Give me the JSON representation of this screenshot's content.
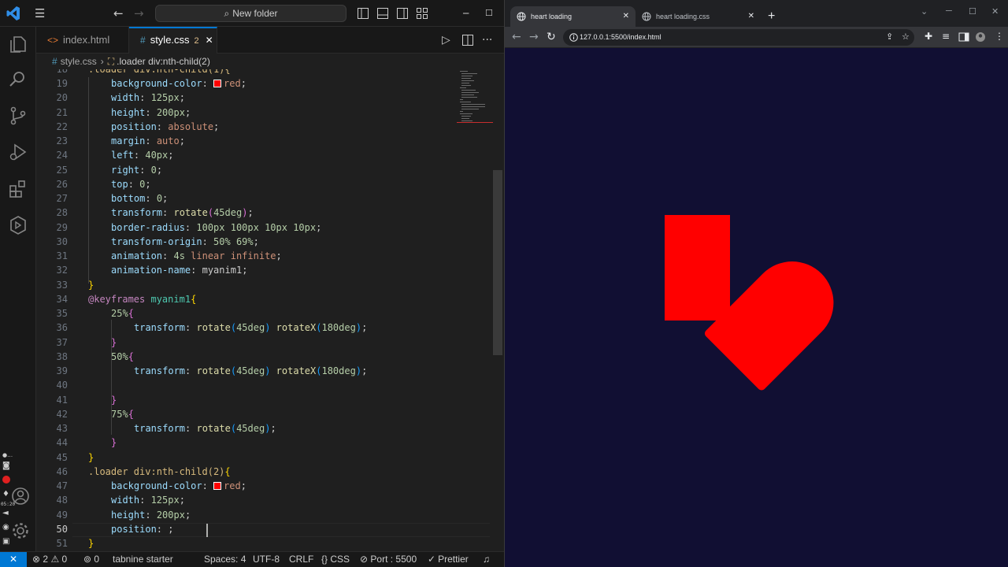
{
  "vscode": {
    "search_label": "New folder",
    "tabs": [
      {
        "label": "index.html",
        "icon": "html-file-icon"
      },
      {
        "label": "style.css",
        "icon": "css-file-icon",
        "badge": "2"
      }
    ],
    "breadcrumb": [
      "style.css",
      ".loader div:nth-child(2)"
    ],
    "partial_top_line": ".loader div:nth-child(1){",
    "lines": [
      {
        "n": "19",
        "indent": 4,
        "tokens": [
          [
            "k-prop",
            "background-color"
          ],
          [
            "",
            "",
            ""
          ],
          [
            "",
            ": "
          ],
          [
            "swatch",
            ""
          ],
          [
            "k-val",
            "red"
          ],
          [
            "",
            ";"
          ]
        ]
      },
      {
        "n": "20",
        "indent": 4,
        "tokens": [
          [
            "k-prop",
            "width"
          ],
          [
            "",
            ": "
          ],
          [
            "k-num",
            "125px"
          ],
          [
            "",
            ";"
          ]
        ]
      },
      {
        "n": "21",
        "indent": 4,
        "tokens": [
          [
            "k-prop",
            "height"
          ],
          [
            "",
            ": "
          ],
          [
            "k-num",
            "200px"
          ],
          [
            "",
            ";"
          ]
        ]
      },
      {
        "n": "22",
        "indent": 4,
        "tokens": [
          [
            "k-prop",
            "position"
          ],
          [
            "",
            ": "
          ],
          [
            "k-val",
            "absolute"
          ],
          [
            "",
            ";"
          ]
        ]
      },
      {
        "n": "23",
        "indent": 4,
        "tokens": [
          [
            "k-prop",
            "margin"
          ],
          [
            "",
            ": "
          ],
          [
            "k-val",
            "auto"
          ],
          [
            "",
            ";"
          ]
        ]
      },
      {
        "n": "24",
        "indent": 4,
        "tokens": [
          [
            "k-prop",
            "left"
          ],
          [
            "",
            ": "
          ],
          [
            "k-num",
            "40px"
          ],
          [
            "",
            ";"
          ]
        ]
      },
      {
        "n": "25",
        "indent": 4,
        "tokens": [
          [
            "k-prop",
            "right"
          ],
          [
            "",
            ": "
          ],
          [
            "k-num",
            "0"
          ],
          [
            "",
            ";"
          ]
        ]
      },
      {
        "n": "26",
        "indent": 4,
        "tokens": [
          [
            "k-prop",
            "top"
          ],
          [
            "",
            ": "
          ],
          [
            "k-num",
            "0"
          ],
          [
            "",
            ";"
          ]
        ]
      },
      {
        "n": "27",
        "indent": 4,
        "tokens": [
          [
            "k-prop",
            "bottom"
          ],
          [
            "",
            ": "
          ],
          [
            "k-num",
            "0"
          ],
          [
            "",
            ";"
          ]
        ]
      },
      {
        "n": "28",
        "indent": 4,
        "tokens": [
          [
            "k-prop",
            "transform"
          ],
          [
            "",
            ": "
          ],
          [
            "k-fn",
            "rotate"
          ],
          [
            "k-b2",
            "("
          ],
          [
            "k-num",
            "45deg"
          ],
          [
            "k-b2",
            ")"
          ],
          [
            "",
            ";"
          ]
        ]
      },
      {
        "n": "29",
        "indent": 4,
        "tokens": [
          [
            "k-prop",
            "border-radius"
          ],
          [
            "",
            ": "
          ],
          [
            "k-num",
            "100px 100px 10px 10px"
          ],
          [
            "",
            ";"
          ]
        ]
      },
      {
        "n": "30",
        "indent": 4,
        "tokens": [
          [
            "k-prop",
            "transform-origin"
          ],
          [
            "",
            ": "
          ],
          [
            "k-num",
            "50% 69%"
          ],
          [
            "",
            ";"
          ]
        ]
      },
      {
        "n": "31",
        "indent": 4,
        "tokens": [
          [
            "k-prop",
            "animation"
          ],
          [
            "",
            ": "
          ],
          [
            "k-num",
            "4s"
          ],
          [
            "k-val",
            " linear infinite"
          ],
          [
            "",
            ";"
          ]
        ]
      },
      {
        "n": "32",
        "indent": 4,
        "tokens": [
          [
            "k-prop",
            "animation-name"
          ],
          [
            "",
            ": "
          ],
          [
            "",
            "myanim1"
          ],
          [
            "",
            ";"
          ]
        ]
      },
      {
        "n": "33",
        "indent": 0,
        "tokens": [
          [
            "k-b1",
            "}"
          ]
        ]
      },
      {
        "n": "34",
        "indent": 0,
        "tokens": [
          [
            "k-at",
            "@keyframes"
          ],
          [
            "",
            " "
          ],
          [
            "k-anim",
            "myanim1"
          ],
          [
            "k-b1",
            "{"
          ]
        ]
      },
      {
        "n": "35",
        "indent": 4,
        "tokens": [
          [
            "k-num",
            "25%"
          ],
          [
            "k-b2",
            "{"
          ]
        ]
      },
      {
        "n": "36",
        "indent": 8,
        "tokens": [
          [
            "k-prop",
            "transform"
          ],
          [
            "",
            ": "
          ],
          [
            "k-fn",
            "rotate"
          ],
          [
            "k-b3",
            "("
          ],
          [
            "k-num",
            "45deg"
          ],
          [
            "k-b3",
            ")"
          ],
          [
            "",
            " "
          ],
          [
            "k-fn",
            "rotateX"
          ],
          [
            "k-b3",
            "("
          ],
          [
            "k-num",
            "180deg"
          ],
          [
            "k-b3",
            ")"
          ],
          [
            "",
            ";"
          ]
        ]
      },
      {
        "n": "37",
        "indent": 4,
        "tokens": [
          [
            "k-b2",
            "}"
          ]
        ]
      },
      {
        "n": "38",
        "indent": 4,
        "tokens": [
          [
            "k-num",
            "50%"
          ],
          [
            "k-b2",
            "{"
          ]
        ]
      },
      {
        "n": "39",
        "indent": 8,
        "tokens": [
          [
            "k-prop",
            "transform"
          ],
          [
            "",
            ": "
          ],
          [
            "k-fn",
            "rotate"
          ],
          [
            "k-b3",
            "("
          ],
          [
            "k-num",
            "45deg"
          ],
          [
            "k-b3",
            ")"
          ],
          [
            "",
            " "
          ],
          [
            "k-fn",
            "rotateX"
          ],
          [
            "k-b3",
            "("
          ],
          [
            "k-num",
            "180deg"
          ],
          [
            "k-b3",
            ")"
          ],
          [
            "",
            ";"
          ]
        ]
      },
      {
        "n": "40",
        "indent": 0,
        "tokens": []
      },
      {
        "n": "41",
        "indent": 4,
        "tokens": [
          [
            "k-b2",
            "}"
          ]
        ]
      },
      {
        "n": "42",
        "indent": 4,
        "tokens": [
          [
            "k-num",
            "75%"
          ],
          [
            "k-b2",
            "{"
          ]
        ]
      },
      {
        "n": "43",
        "indent": 8,
        "tokens": [
          [
            "k-prop",
            "transform"
          ],
          [
            "",
            ": "
          ],
          [
            "k-fn",
            "rotate"
          ],
          [
            "k-b3",
            "("
          ],
          [
            "k-num",
            "45deg"
          ],
          [
            "k-b3",
            ")"
          ],
          [
            "",
            ";"
          ]
        ]
      },
      {
        "n": "44",
        "indent": 4,
        "tokens": [
          [
            "k-b2",
            "}"
          ]
        ]
      },
      {
        "n": "45",
        "indent": 0,
        "tokens": [
          [
            "k-b1",
            "}"
          ]
        ]
      },
      {
        "n": "46",
        "indent": 0,
        "tokens": [
          [
            "k-sel",
            ".loader div:nth-child(2)"
          ],
          [
            "k-b1",
            "{"
          ]
        ]
      },
      {
        "n": "47",
        "indent": 4,
        "tokens": [
          [
            "k-prop",
            "background-color"
          ],
          [
            "",
            ": "
          ],
          [
            "swatch",
            ""
          ],
          [
            "k-val",
            "red"
          ],
          [
            "",
            ";"
          ]
        ]
      },
      {
        "n": "48",
        "indent": 4,
        "tokens": [
          [
            "k-prop",
            "width"
          ],
          [
            "",
            ": "
          ],
          [
            "k-num",
            "125px"
          ],
          [
            "",
            ";"
          ]
        ]
      },
      {
        "n": "49",
        "indent": 4,
        "tokens": [
          [
            "k-prop",
            "height"
          ],
          [
            "",
            ": "
          ],
          [
            "k-num",
            "200px"
          ],
          [
            "",
            ";"
          ]
        ]
      },
      {
        "n": "50",
        "indent": 4,
        "tokens": [
          [
            "k-prop",
            "position"
          ],
          [
            "",
            ": "
          ],
          [
            "",
            ";"
          ]
        ]
      },
      {
        "n": "51",
        "indent": 0,
        "tokens": [
          [
            "k-b1",
            "}"
          ]
        ]
      }
    ],
    "current_line": "50",
    "status": {
      "errors": "2",
      "warnings": "0",
      "ports_forwarded": "0",
      "tabnine": "tabnine starter",
      "spaces": "Spaces: 4",
      "encoding": "UTF-8",
      "eol": "CRLF",
      "language": "CSS",
      "port": "Port : 5500",
      "prettier": "Prettier"
    },
    "overlay_clock": "05:20"
  },
  "browser": {
    "tabs": [
      {
        "label": "heart loading"
      },
      {
        "label": "heart loading.css"
      }
    ],
    "url": "127.0.0.1:5500/index.html",
    "page_background": "#110f33",
    "shape_color": "#ff0000"
  }
}
